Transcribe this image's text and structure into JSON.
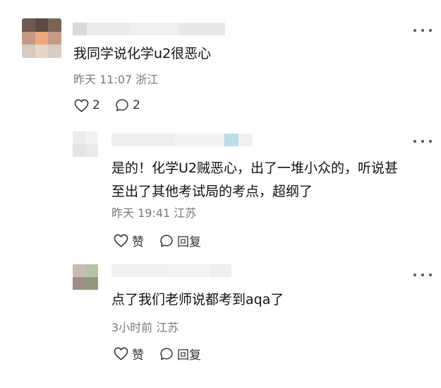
{
  "comments": [
    {
      "text": "我同学说化学u2很恶心",
      "time": "昨天 11:07",
      "location": "浙江",
      "likes": "2",
      "replies": "2",
      "icons": {
        "like": "heart-outline-icon",
        "reply": "speech-bubble-icon",
        "more": "more-dots-icon"
      }
    },
    {
      "text_line1": "是的！化学U2贼恶心，出了一堆小众的，听说甚",
      "text_line2": "至出了其他考试局的考点，超纲了",
      "time": "昨天 19:41",
      "location": "江苏",
      "like_label": "赞",
      "reply_label": "回复"
    },
    {
      "text": "点了我们老师说都考到aqa了",
      "time": "3小时前",
      "location": "江苏",
      "like_label": "赞",
      "reply_label": "回复"
    }
  ],
  "colors": {
    "text": "#111111",
    "meta": "#7a7a7a",
    "icon": "#333333",
    "background": "#ffffff"
  }
}
